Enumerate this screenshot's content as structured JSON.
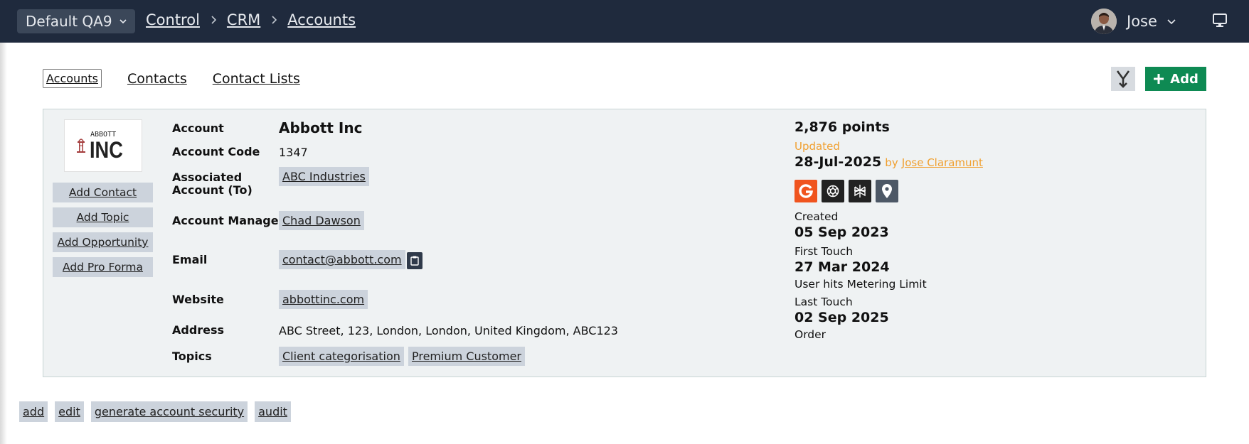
{
  "header": {
    "environment": "Default QA9",
    "breadcrumb": [
      "Control",
      "CRM",
      "Accounts"
    ],
    "user_name": "Jose"
  },
  "tabs": [
    {
      "label": "Accounts",
      "active": true
    },
    {
      "label": "Contacts",
      "active": false
    },
    {
      "label": "Contact Lists",
      "active": false
    }
  ],
  "toolbar": {
    "add_label": "Add"
  },
  "logo": {
    "line1": "ABBOTT",
    "line2": "INC"
  },
  "side_actions": [
    "Add Contact",
    "Add Topic",
    "Add Opportunity",
    "Add Pro Forma"
  ],
  "account": {
    "labels": {
      "account": "Account",
      "code": "Account Code",
      "associated_line1": "Associated",
      "associated_line2": "Account (To)",
      "manager": "Account Manager",
      "email": "Email",
      "website": "Website",
      "address": "Address",
      "topics": "Topics"
    },
    "name": "Abbott Inc",
    "code": "1347",
    "associated": "ABC Industries",
    "manager": "Chad Dawson",
    "email": "contact@abbott.com",
    "website": "abbottinc.com",
    "address": "ABC Street, 123, London, London, United Kingdom, ABC123",
    "topics": [
      "Client categorisation",
      "Premium Customer"
    ]
  },
  "stats": {
    "points": "2,876 points",
    "updated_label": "Updated",
    "updated_date": "28-Jul-2025",
    "by": "by",
    "updated_by": "Jose Claramunt",
    "icons": [
      "google-icon",
      "openai-icon",
      "perplexity-icon",
      "map-pin-icon"
    ],
    "created_label": "Created",
    "created_date": "05 Sep 2023",
    "first_touch_label": "First Touch",
    "first_touch_date": "27 Mar 2024",
    "first_touch_note": "User hits Metering Limit",
    "last_touch_label": "Last Touch",
    "last_touch_date": "02 Sep 2025",
    "last_touch_note": "Order"
  },
  "bottom_actions": [
    "add",
    "edit",
    "generate account security",
    "audit"
  ],
  "colors": {
    "topbar": "#1f2a3d",
    "accent_green": "#0e8a53",
    "orange": "#f0a030",
    "google_red": "#f0541e"
  }
}
